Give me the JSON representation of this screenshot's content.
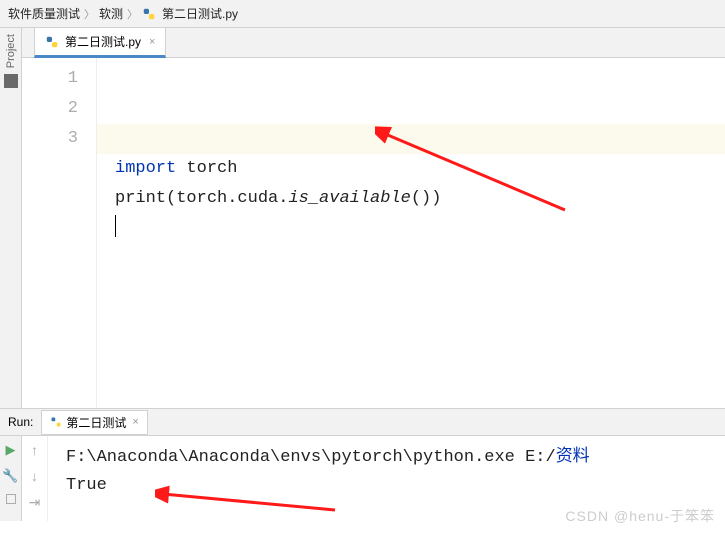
{
  "breadcrumb": {
    "root": "软件质量测试",
    "mid": "软测",
    "file": "第二日测试.py"
  },
  "sidebar": {
    "label": "Project"
  },
  "editor": {
    "tab": {
      "name": "第二日测试.py"
    },
    "lines": {
      "l1": "1",
      "l2": "2",
      "l3": "3"
    },
    "code": {
      "kw_import": "import",
      "mod": " torch",
      "call_pre": "print(torch.cuda.",
      "call_fn": "is_available",
      "call_post": "())"
    }
  },
  "run": {
    "label": "Run:",
    "tab": "第二日测试",
    "output_path": "F:\\Anaconda\\Anaconda\\envs\\pytorch\\python.exe E:/",
    "output_path_cn": "资料",
    "output_result": "True"
  },
  "watermark": "CSDN @henu-于笨笨"
}
